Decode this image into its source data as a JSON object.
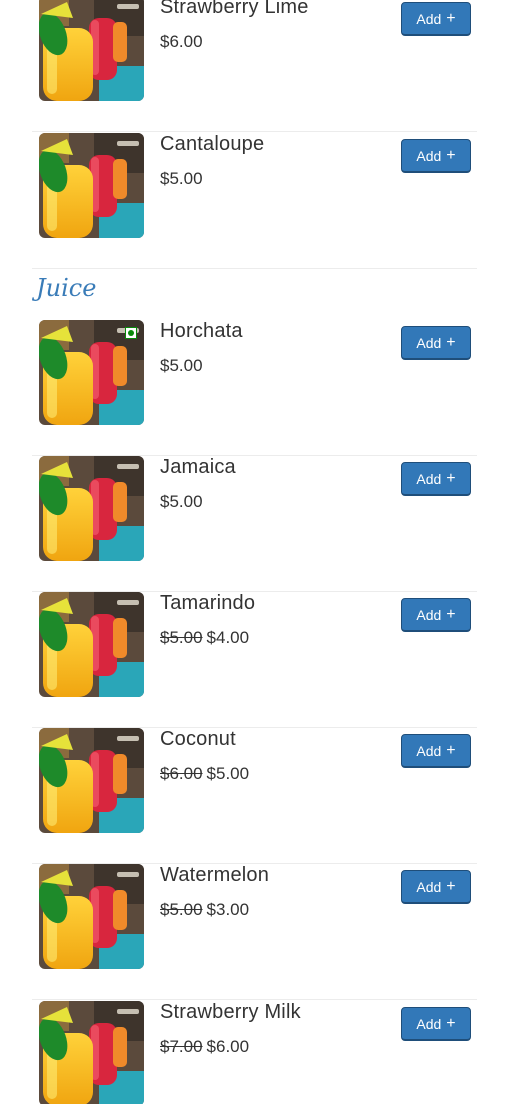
{
  "sections": [
    {
      "title": "",
      "items": [
        {
          "name": "Strawberry Lime",
          "price": "$6.00",
          "old_price": "",
          "add_label": "Add",
          "add_symbol": "+"
        },
        {
          "name": "Cantaloupe",
          "price": "$5.00",
          "old_price": "",
          "add_label": "Add",
          "add_symbol": "+"
        }
      ]
    },
    {
      "title": "Juice",
      "items": [
        {
          "name": "Horchata",
          "price": "$5.00",
          "old_price": "",
          "add_label": "Add",
          "add_symbol": "+",
          "badge": "veg-icon"
        },
        {
          "name": "Jamaica",
          "price": "$5.00",
          "old_price": "",
          "add_label": "Add",
          "add_symbol": "+"
        },
        {
          "name": "Tamarindo",
          "price": "$4.00",
          "old_price": "$5.00",
          "add_label": "Add",
          "add_symbol": "+"
        },
        {
          "name": "Coconut",
          "price": "$5.00",
          "old_price": "$6.00",
          "add_label": "Add",
          "add_symbol": "+"
        },
        {
          "name": "Watermelon",
          "price": "$3.00",
          "old_price": "$5.00",
          "add_label": "Add",
          "add_symbol": "+"
        },
        {
          "name": "Strawberry Milk",
          "price": "$6.00",
          "old_price": "$7.00",
          "add_label": "Add",
          "add_symbol": "+"
        }
      ]
    }
  ],
  "colors": {
    "accent": "#3278b8",
    "section_title": "#3a7cb8",
    "veg_badge": "#0a8a0a"
  }
}
